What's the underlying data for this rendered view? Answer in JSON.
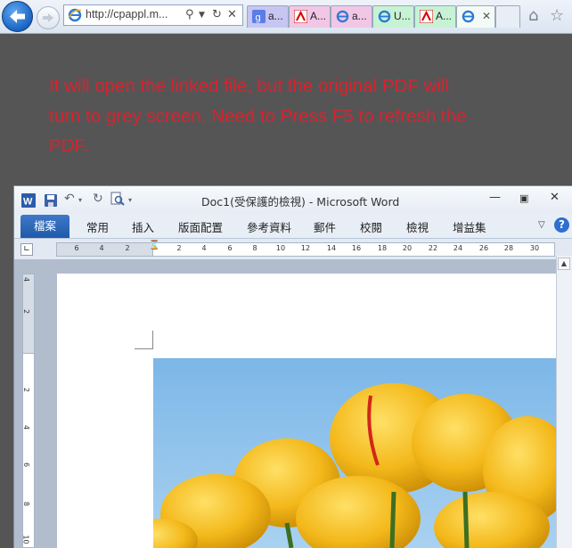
{
  "browser": {
    "url": "http://cpappl.m...",
    "tabs": [
      {
        "label": "a...",
        "icon": "google-icon",
        "color": "#c7c5f2"
      },
      {
        "label": "A...",
        "icon": "adobe-pdf-icon",
        "color": "#f2c7e6"
      },
      {
        "label": "a...",
        "icon": "ie-icon",
        "color": "#f2c7e6"
      },
      {
        "label": "U...",
        "icon": "ie-icon",
        "color": "#c7f2d4"
      },
      {
        "label": "A...",
        "icon": "adobe-pdf-icon",
        "color": "#c7f2d4"
      },
      {
        "label": "",
        "icon": "ie-icon",
        "color": "#d7f5dc",
        "active": true
      }
    ]
  },
  "message": "It will open the linked file, but the original PDF will turn to grey screen. Need to Press F5 to refresh the PDF.",
  "word": {
    "title": "Doc1(受保護的檢視) - Microsoft Word",
    "file_tab": "檔案",
    "tabs": [
      "常用",
      "插入",
      "版面配置",
      "參考資料",
      "郵件",
      "校閱",
      "檢視",
      "增益集"
    ],
    "ruler_labels": [
      "6",
      "4",
      "2",
      "2",
      "2",
      "4",
      "6",
      "8",
      "10",
      "12",
      "14",
      "16",
      "18",
      "20",
      "22",
      "24",
      "26",
      "28",
      "30"
    ],
    "vruler_labels": [
      "4",
      "2",
      "2",
      "2",
      "4",
      "6",
      "8",
      "10"
    ]
  }
}
